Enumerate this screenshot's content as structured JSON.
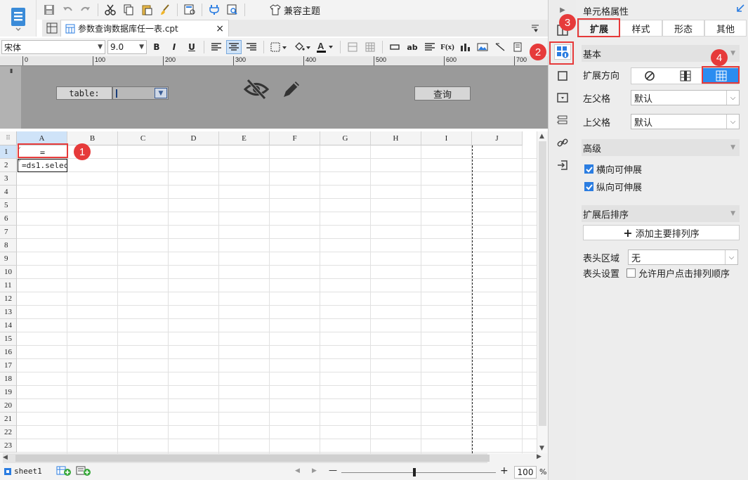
{
  "toolbar": {
    "theme_label": "兼容主题"
  },
  "file_tab": {
    "name": "参数查询数据库任一表.cpt",
    "close": "×"
  },
  "format_bar": {
    "font_family": "宋体",
    "font_size": "9.0",
    "bold": "B",
    "italic": "I",
    "underline": "U",
    "fx": "F(x)",
    "ab": "ab"
  },
  "ruler": {
    "marks": [
      "0",
      "100",
      "200",
      "300",
      "400",
      "500",
      "600",
      "700"
    ]
  },
  "param_pane": {
    "table_label": "table:",
    "query_button": "查询"
  },
  "grid": {
    "columns": [
      "A",
      "B",
      "C",
      "D",
      "E",
      "F",
      "G",
      "H",
      "I",
      "J"
    ],
    "rows": [
      "1",
      "2",
      "3",
      "4",
      "5",
      "6",
      "7",
      "8",
      "9",
      "10",
      "11",
      "12",
      "13",
      "14",
      "15",
      "16",
      "17",
      "18",
      "19",
      "20",
      "21",
      "22",
      "23"
    ],
    "cell_a1": "=",
    "cell_a2": "=ds1.selec"
  },
  "bottom_bar": {
    "sheet_name": "sheet1",
    "zoom_minus": "—",
    "zoom_plus": "+",
    "zoom_value": "100",
    "zoom_unit": "%"
  },
  "panel": {
    "title": "单元格属性",
    "tabs": [
      "扩展",
      "样式",
      "形态",
      "其他"
    ],
    "section_basic": "基本",
    "expand_direction_label": "扩展方向",
    "left_parent_label": "左父格",
    "left_parent_value": "默认",
    "top_parent_label": "上父格",
    "top_parent_value": "默认",
    "section_advanced": "高级",
    "horizontal_extend": "横向可伸展",
    "vertical_extend": "纵向可伸展",
    "section_sort": "扩展后排序",
    "add_sort_button": "添加主要排列序",
    "header_area_label": "表头区域",
    "header_area_value": "无",
    "header_setting_label": "表头设置",
    "allow_user_sort": "允许用户点击排列顺序"
  },
  "badges": [
    "1",
    "2",
    "3",
    "4"
  ],
  "colors": {
    "accent": "#2b7de1",
    "highlight": "#e63a3a",
    "param_bg": "#9a9a9a"
  }
}
